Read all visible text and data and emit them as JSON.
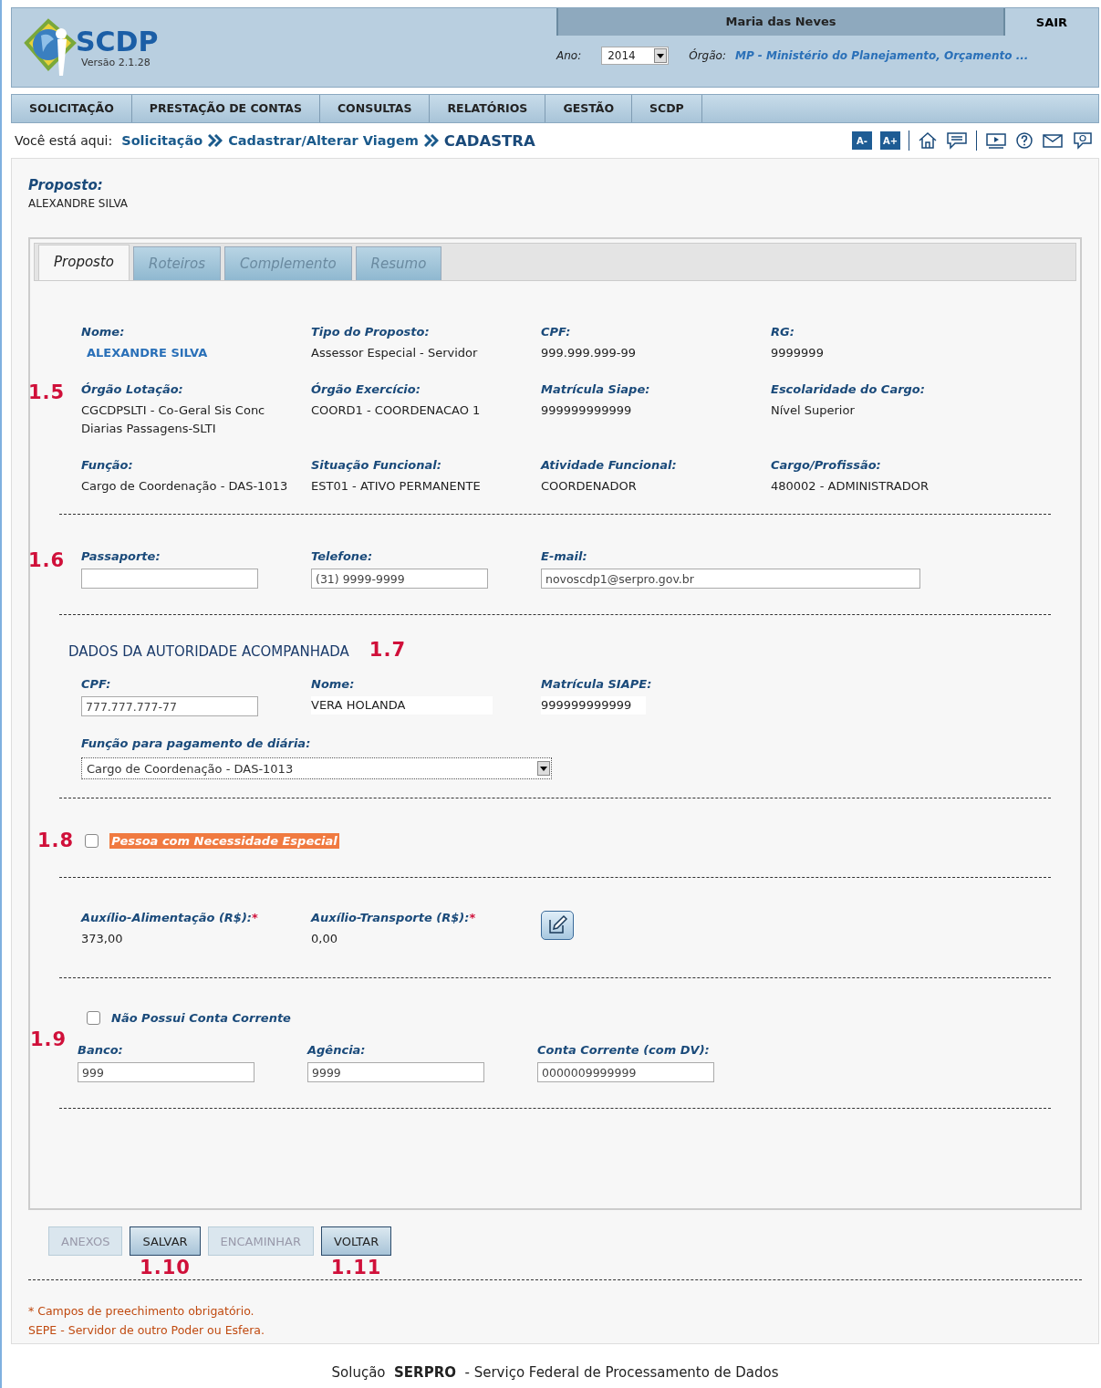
{
  "header": {
    "logo_text": "SCDP",
    "version": "Versão 2.1.28",
    "user": "Maria das Neves",
    "logout": "SAIR",
    "year_label": "Ano:",
    "year": "2014",
    "org_label": "Órgão:",
    "org": "MP - Ministério do Planejamento, Orçamento ..."
  },
  "menu": [
    "SOLICITAÇÃO",
    "PRESTAÇÃO DE CONTAS",
    "CONSULTAS",
    "RELATÓRIOS",
    "GESTÃO",
    "SCDP"
  ],
  "breadcrumb": {
    "label": "Você está aqui:",
    "items": [
      {
        "text": "Solicitação",
        "current": false
      },
      {
        "text": "Cadastrar/Alterar Viagem",
        "current": false
      },
      {
        "text": "CADASTRA",
        "current": true
      }
    ]
  },
  "font_buttons": [
    "A-",
    "A+"
  ],
  "proposto": {
    "label": "Proposto:",
    "value": "ALEXANDRE SILVA"
  },
  "tabs": [
    {
      "label": "Proposto",
      "selected": true
    },
    {
      "label": "Roteiros",
      "selected": false
    },
    {
      "label": "Complemento",
      "selected": false
    },
    {
      "label": "Resumo",
      "selected": false
    }
  ],
  "personal": {
    "marker": "1.5",
    "fields": [
      {
        "label": "Nome:",
        "value": "ALEXANDRE SILVA",
        "kind": "link"
      },
      {
        "label": "Tipo do Proposto:",
        "value": "Assessor Especial - Servidor",
        "kind": "text"
      },
      {
        "label": "CPF:",
        "value": "999.999.999-99",
        "kind": "text"
      },
      {
        "label": "RG:",
        "value": "9999999",
        "kind": "text"
      },
      {
        "label": "Órgão Lotação:",
        "value": "CGCDPSLTI - Co-Geral Sis Conc Diarias Passagens-SLTI",
        "kind": "text"
      },
      {
        "label": "Órgão Exercício:",
        "value": "COORD1 - COORDENACAO 1",
        "kind": "text"
      },
      {
        "label": "Matrícula Siape:",
        "value": "999999999999",
        "kind": "text"
      },
      {
        "label": "Escolaridade do Cargo:",
        "value": "Nível Superior",
        "kind": "text"
      },
      {
        "label": "Função:",
        "value": "Cargo de Coordenação - DAS-1013",
        "kind": "text"
      },
      {
        "label": "Situação Funcional:",
        "value": "EST01 - ATIVO PERMANENTE",
        "kind": "text"
      },
      {
        "label": "Atividade Funcional:",
        "value": "COORDENADOR",
        "kind": "text"
      },
      {
        "label": "Cargo/Profissão:",
        "value": "480002 - ADMINISTRADOR",
        "kind": "text"
      }
    ]
  },
  "contact": {
    "marker": "1.6",
    "fields": [
      {
        "label": "Passaporte:"
      },
      {
        "label": "Telefone:",
        "value": "(31) 9999-9999"
      },
      {
        "label": "E-mail:",
        "value": "novoscdp1@serpro.gov.br"
      }
    ]
  },
  "authority": {
    "heading": "DADOS DA AUTORIDADE ACOMPANHADA",
    "marker": "1.7",
    "cpf_label": "CPF:",
    "cpf": "777.777.777-77",
    "name_label": "Nome:",
    "name": "VERA HOLANDA",
    "siape_label": "Matrícula SIAPE:",
    "siape": "999999999999",
    "function_label": "Função para pagamento de diária:",
    "function": "Cargo de Coordenação - DAS-1013"
  },
  "special_need": {
    "marker": "1.8",
    "label": "Pessoa com Necessidade Especial",
    "checked": false
  },
  "allowances": [
    {
      "label": "Auxílio-Alimentação (R$):",
      "required_mark": "*",
      "value": "373,00"
    },
    {
      "label": "Auxílio-Transporte (R$):",
      "required_mark": "*",
      "value": "0,00"
    }
  ],
  "bank": {
    "marker": "1.9",
    "no_account_label": "Não Possui Conta Corrente",
    "no_account": false,
    "fields": [
      {
        "label": "Banco:",
        "value": "999"
      },
      {
        "label": "Agência:",
        "value": "9999"
      },
      {
        "label": "Conta Corrente (com DV):",
        "value": "0000009999999"
      }
    ]
  },
  "buttons": [
    {
      "label": "ANEXOS",
      "disabled": true
    },
    {
      "label": "SALVAR",
      "disabled": false,
      "marker": "1.10"
    },
    {
      "label": "ENCAMINHAR",
      "disabled": true
    },
    {
      "label": "VOLTAR",
      "disabled": false,
      "marker": "1.11"
    }
  ],
  "notes": [
    "* Campos de preechimento obrigatório.",
    "SEPE - Servidor de outro Poder ou Esfera."
  ],
  "footer": "Solução  **SERPRO**  - Serviço Federal de Processamento de Dados"
}
